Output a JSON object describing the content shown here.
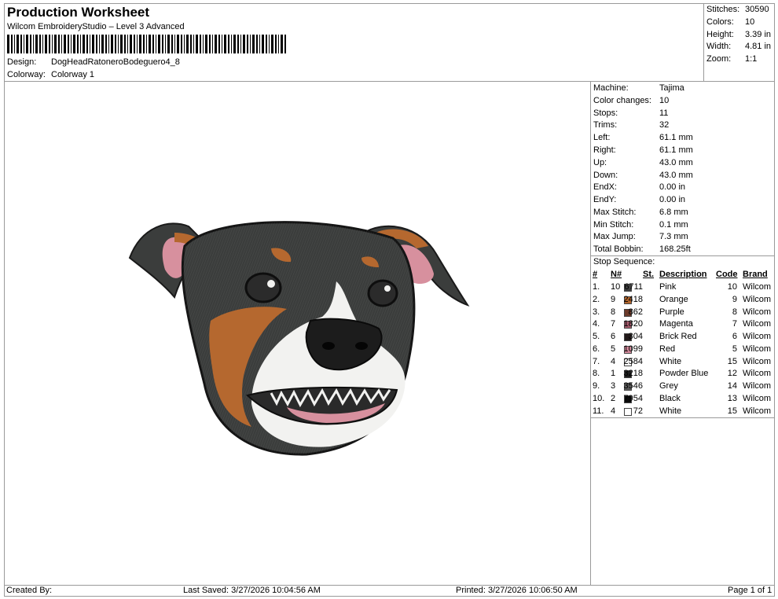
{
  "header": {
    "title": "Production Worksheet",
    "subtitle": "Wilcom EmbroideryStudio – Level 3 Advanced",
    "design_label": "Design:",
    "design_value": "DogHeadRatoneroBodeguero4_8",
    "colorway_label": "Colorway:",
    "colorway_value": "Colorway 1"
  },
  "stats": {
    "stitches_label": "Stitches:",
    "stitches_value": "30590",
    "colors_label": "Colors:",
    "colors_value": "10",
    "height_label": "Height:",
    "height_value": "3.39 in",
    "width_label": "Width:",
    "width_value": "4.81 in",
    "zoom_label": "Zoom:",
    "zoom_value": "1:1"
  },
  "machine_info": [
    {
      "label": "Machine:",
      "value": "Tajima"
    },
    {
      "label": "Color changes:",
      "value": "10"
    },
    {
      "label": "Stops:",
      "value": "11"
    },
    {
      "label": "Trims:",
      "value": "32"
    },
    {
      "label": "Left:",
      "value": "61.1 mm"
    },
    {
      "label": "Right:",
      "value": "61.1 mm"
    },
    {
      "label": "Up:",
      "value": "43.0 mm"
    },
    {
      "label": "Down:",
      "value": "43.0 mm"
    },
    {
      "label": "EndX:",
      "value": "0.00 in"
    },
    {
      "label": "EndY:",
      "value": "0.00 in"
    },
    {
      "label": "Max Stitch:",
      "value": "6.8 mm"
    },
    {
      "label": "Min Stitch:",
      "value": "0.1 mm"
    },
    {
      "label": "Max Jump:",
      "value": "7.3 mm"
    },
    {
      "label": "Total Bobbin:",
      "value": "168.25ft"
    }
  ],
  "stop_sequence": {
    "title": "Stop Sequence:",
    "columns": {
      "idx": "#",
      "n": "N#",
      "st": "St.",
      "desc": "Description",
      "code": "Code",
      "brand": "Brand"
    },
    "rows": [
      {
        "idx": "1.",
        "n": "10",
        "color": "#3f3f3f",
        "st": "6711",
        "desc": "Pink",
        "code": "10",
        "brand": "Wilcom"
      },
      {
        "idx": "2.",
        "n": "9",
        "color": "#b2652c",
        "st": "2418",
        "desc": "Orange",
        "code": "9",
        "brand": "Wilcom"
      },
      {
        "idx": "3.",
        "n": "8",
        "color": "#6b3a2a",
        "st": "862",
        "desc": "Purple",
        "code": "8",
        "brand": "Wilcom"
      },
      {
        "idx": "4.",
        "n": "7",
        "color": "#a35a6b",
        "st": "1820",
        "desc": "Magenta",
        "code": "7",
        "brand": "Wilcom"
      },
      {
        "idx": "5.",
        "n": "6",
        "color": "#221a1a",
        "st": "304",
        "desc": "Brick Red",
        "code": "6",
        "brand": "Wilcom"
      },
      {
        "idx": "6.",
        "n": "5",
        "color": "#d48a9c",
        "st": "1099",
        "desc": "Red",
        "code": "5",
        "brand": "Wilcom"
      },
      {
        "idx": "7.",
        "n": "4",
        "color": "#ffffff",
        "st": "2584",
        "desc": "White",
        "code": "15",
        "brand": "Wilcom"
      },
      {
        "idx": "8.",
        "n": "1",
        "color": "#1e1e1e",
        "st": "3218",
        "desc": "Powder Blue",
        "code": "12",
        "brand": "Wilcom"
      },
      {
        "idx": "9.",
        "n": "3",
        "color": "#5a5a5a",
        "st": "3546",
        "desc": "Grey",
        "code": "14",
        "brand": "Wilcom"
      },
      {
        "idx": "10.",
        "n": "2",
        "color": "#0a0a0a",
        "st": "7954",
        "desc": "Black",
        "code": "13",
        "brand": "Wilcom"
      },
      {
        "idx": "11.",
        "n": "4",
        "color": "#ffffff",
        "st": "72",
        "desc": "White",
        "code": "15",
        "brand": "Wilcom"
      }
    ]
  },
  "footer": {
    "created_by": "Created By:",
    "last_saved": "Last Saved: 3/27/2026 10:04:56 AM",
    "printed": "Printed: 3/27/2026 10:06:50 AM",
    "page": "Page 1 of 1"
  },
  "design_preview": {
    "subject": "embroidered dog head",
    "colors": {
      "dark": "#3b3d3c",
      "tan": "#b5682f",
      "white": "#f2f2f0",
      "pink": "#d7909e",
      "black": "#141414"
    }
  }
}
